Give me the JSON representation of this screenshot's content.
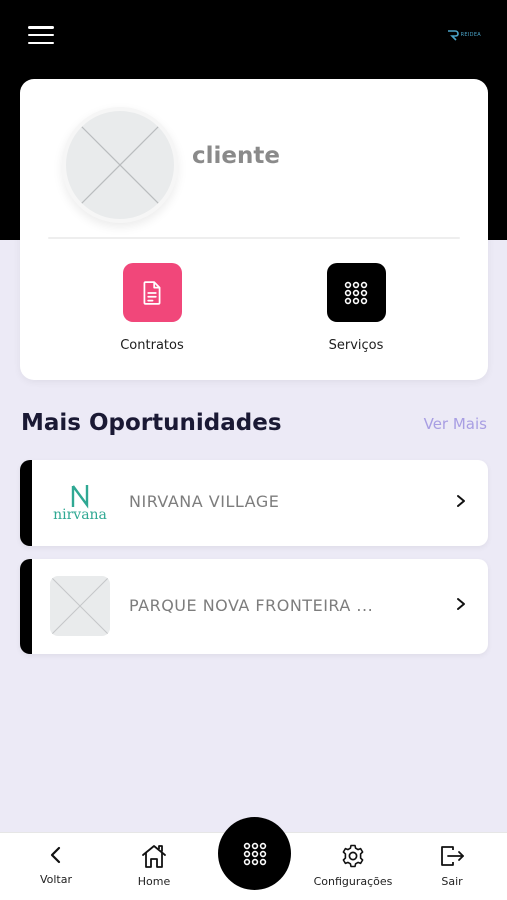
{
  "header": {
    "menu_icon": "hamburger-menu-icon",
    "brand_text": "REIDEA"
  },
  "profile": {
    "name": "cliente",
    "avatar_icon": "image-placeholder-icon"
  },
  "actions": [
    {
      "label": "Contratos",
      "icon": "document-icon",
      "color": "#f1477a"
    },
    {
      "label": "Serviços",
      "icon": "grid-dots-icon",
      "color": "#000000"
    }
  ],
  "section": {
    "title": "Mais Oportunidades",
    "link": "Ver Mais"
  },
  "opportunities": [
    {
      "title": "NIRVANA VILLAGE",
      "logo_text": "nirvana",
      "logo_letter": "N"
    },
    {
      "title": "PARQUE NOVA FRONTEIRA ..."
    }
  ],
  "bottom_nav": {
    "voltar": "Voltar",
    "home": "Home",
    "config": "Configurações",
    "sair": "Sair"
  },
  "colors": {
    "accent": "#f1477a",
    "link": "#a89ee3",
    "background": "#eceaf6",
    "header": "#000000"
  }
}
